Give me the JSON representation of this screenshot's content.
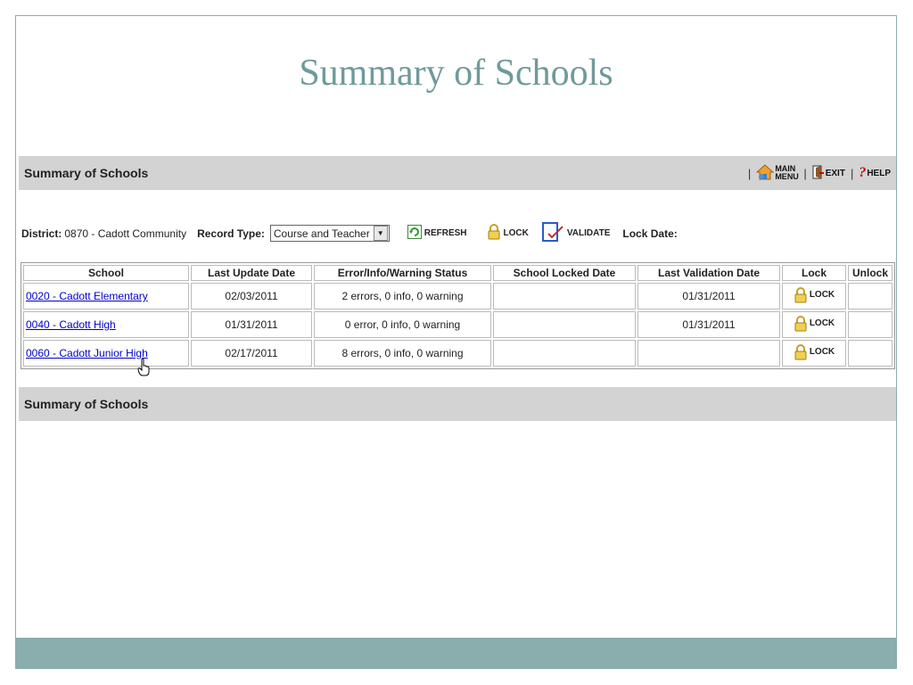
{
  "slide": {
    "title": "Summary of Schools"
  },
  "header_bar": {
    "title": "Summary of Schools",
    "nav": {
      "main_menu": "MAIN MENU",
      "exit": "EXIT",
      "help": "HELP"
    }
  },
  "filters": {
    "district_label": "District:",
    "district_value": "0870 - Cadott Community",
    "record_type_label": "Record Type:",
    "record_type_value": "Course and Teacher",
    "refresh_label": "REFRESH",
    "lock_label": "LOCK",
    "validate_label": "VALIDATE",
    "lock_date_label": "Lock Date:"
  },
  "table": {
    "columns": [
      "School",
      "Last Update Date",
      "Error/Info/Warning Status",
      "School Locked Date",
      "Last Validation Date",
      "Lock",
      "Unlock"
    ],
    "rows": [
      {
        "school": "0020 - Cadott Elementary",
        "last_update": "02/03/2011",
        "status": "2 errors, 0 info, 0 warning",
        "locked_date": "",
        "last_validation": "01/31/2011",
        "lock": "LOCK",
        "unlock": ""
      },
      {
        "school": "0040 - Cadott High",
        "last_update": "01/31/2011",
        "status": "0 error, 0 info, 0 warning",
        "locked_date": "",
        "last_validation": "01/31/2011",
        "lock": "LOCK",
        "unlock": ""
      },
      {
        "school": "0060 - Cadott Junior High",
        "last_update": "02/17/2011",
        "status": "8 errors, 0 info, 0 warning",
        "locked_date": "",
        "last_validation": "",
        "lock": "LOCK",
        "unlock": ""
      }
    ]
  },
  "footer_bar": {
    "title": "Summary of Schools"
  },
  "icons": {
    "home": "home-icon",
    "exit": "exit-door-icon",
    "help": "question-mark-icon",
    "refresh": "refresh-icon",
    "lock": "padlock-icon",
    "validate": "validate-check-icon",
    "cursor": "hand-cursor-icon"
  },
  "colors": {
    "accent": "#8aadae",
    "title": "#6f9a9b",
    "bar": "#d3d3d3",
    "link": "#0000cc"
  }
}
